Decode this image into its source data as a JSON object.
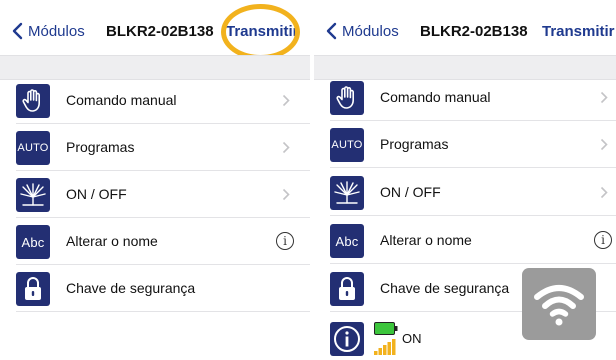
{
  "left": {
    "nav": {
      "back_label": "Módulos",
      "title": "BLKR2-02B138",
      "action_label": "Transmitir"
    },
    "rows": [
      {
        "label": "Comando manual",
        "icon": "hand-icon",
        "trailing": "chevron"
      },
      {
        "label": "Programas",
        "icon_text": "AUTO",
        "trailing": "chevron"
      },
      {
        "label": "ON / OFF",
        "icon": "burst-icon",
        "trailing": "chevron"
      },
      {
        "label": "Alterar o nome",
        "icon_text": "Abc",
        "trailing": "info"
      },
      {
        "label": "Chave de segurança",
        "icon": "lock-icon",
        "trailing": "none"
      }
    ]
  },
  "right": {
    "nav": {
      "back_label": "Módulos",
      "title": "BLKR2-02B138",
      "action_label": "Transmitir"
    },
    "rows": [
      {
        "label": "Comando manual",
        "icon": "hand-icon",
        "trailing": "chevron"
      },
      {
        "label": "Programas",
        "icon_text": "AUTO",
        "trailing": "chevron"
      },
      {
        "label": "ON / OFF",
        "icon": "burst-icon",
        "trailing": "chevron"
      },
      {
        "label": "Alterar o nome",
        "icon_text": "Abc",
        "trailing": "info"
      },
      {
        "label": "Chave de segurança",
        "icon": "lock-icon",
        "trailing": "none"
      }
    ],
    "status": {
      "text": "ON",
      "battery_color": "#3cc53c",
      "signal_color": "#f2b21d"
    },
    "overlay_icon": "wifi-icon"
  },
  "colors": {
    "accent": "#1f3a8f",
    "icon_bg": "#232f73",
    "highlight": "#f2b21d"
  }
}
